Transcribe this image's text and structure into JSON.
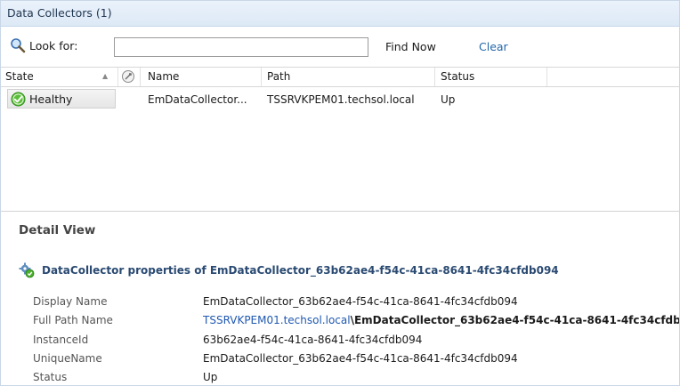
{
  "window": {
    "title": "Data Collectors (1)"
  },
  "toolbar": {
    "look_for_label": "Look for:",
    "search_value": "",
    "find_now_label": "Find Now",
    "clear_label": "Clear",
    "search_icon": "magnifier-icon"
  },
  "grid": {
    "columns": [
      "State",
      "Name",
      "Path",
      "Status"
    ],
    "rows": [
      {
        "state": "Healthy",
        "name": "EmDataCollector...",
        "path": "TSSRVKPEM01.techsol.local",
        "status": "Up"
      }
    ]
  },
  "detail": {
    "title": "Detail View",
    "properties_heading": "DataCollector properties of EmDataCollector_63b62ae4-f54c-41ca-8641-4fc34cfdb094",
    "props": [
      {
        "label": "Display Name",
        "value": "EmDataCollector_63b62ae4-f54c-41ca-8641-4fc34cfdb094"
      },
      {
        "label": "Full Path Name",
        "link": "TSSRVKPEM01.techsol.local",
        "rest": "\\EmDataCollector_63b62ae4-f54c-41ca-8641-4fc34cfdb094"
      },
      {
        "label": "InstanceId",
        "value": "63b62ae4-f54c-41ca-8641-4fc34cfdb094"
      },
      {
        "label": "UniqueName",
        "value": "EmDataCollector_63b62ae4-f54c-41ca-8641-4fc34cfdb094"
      },
      {
        "label": "Status",
        "value": "Up"
      }
    ]
  },
  "colors": {
    "link": "#1f58b0",
    "healthy": "#3aa52a",
    "heading": "#2a4a72"
  }
}
